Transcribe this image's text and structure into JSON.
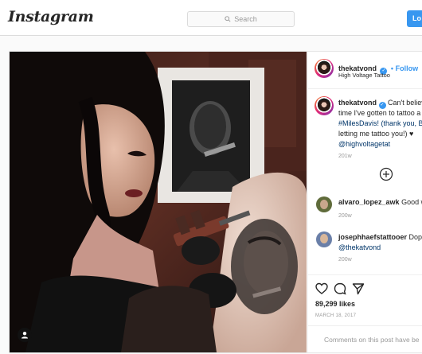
{
  "topbar": {
    "logo": "Instagram",
    "search_placeholder": "Search",
    "login_label": "Lo"
  },
  "post": {
    "username": "thekatvond",
    "follow_label": "• Follow",
    "location": "High Voltage Tattoo",
    "caption": {
      "username": "thekatvond",
      "lines": [
        "Can't believe",
        "time I've gotten to tattoo a",
        "#MilesDavis! (thank you, Bl",
        "letting me tattoo you!) ♥",
        "@highvoltagetat"
      ],
      "time": "201w"
    },
    "comments": [
      {
        "username": "alvaro_lopez_awk",
        "text": "Good wo",
        "time": "200w"
      },
      {
        "username": "josephhaefstattooer",
        "text": "Dope",
        "mention": "@thekatvond",
        "time": "200w"
      }
    ],
    "likes": "89,299 likes",
    "date": "MARCH 18, 2017",
    "comment_placeholder": "Comments on this post have be"
  },
  "icons": [
    "search-icon",
    "verified-badge-icon",
    "load-more-comments-icon",
    "heart-icon",
    "comment-icon",
    "share-icon",
    "user-tag-icon"
  ],
  "colors": {
    "accent": "#3897f0",
    "link": "#003569",
    "muted": "#999999",
    "border": "#dbdbdb"
  }
}
